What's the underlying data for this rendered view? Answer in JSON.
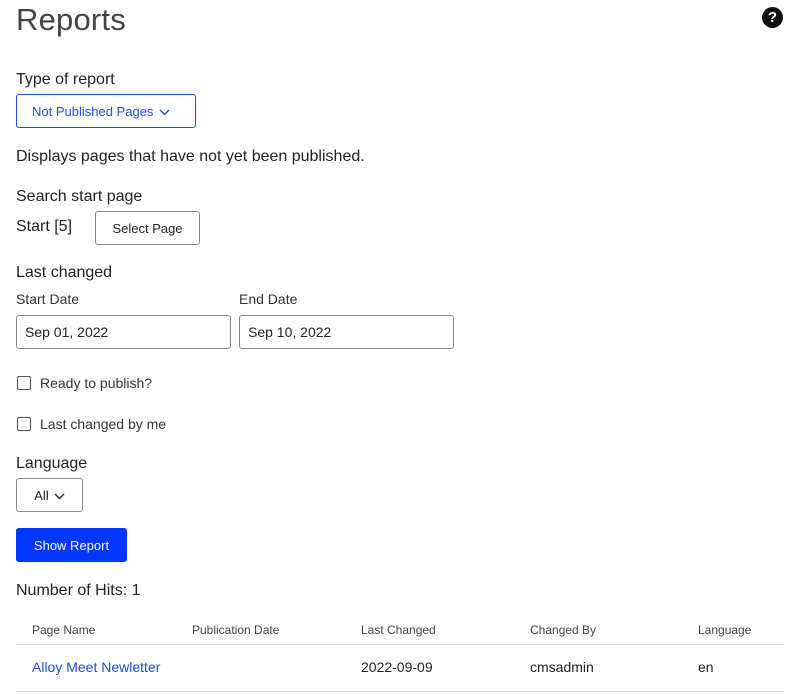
{
  "header": {
    "title": "Reports",
    "help_icon": "?"
  },
  "report_type": {
    "label": "Type of report",
    "selected": "Not Published Pages",
    "description": "Displays pages that have not yet been published."
  },
  "search": {
    "label": "Search start page",
    "start_value": "Start [5]",
    "select_button": "Select Page"
  },
  "last_changed": {
    "label": "Last changed",
    "start_label": "Start Date",
    "start_value": "Sep 01, 2022",
    "end_label": "End Date",
    "end_value": "Sep 10, 2022"
  },
  "filters": {
    "ready_to_publish": "Ready to publish?",
    "changed_by_me": "Last changed by me"
  },
  "language": {
    "label": "Language",
    "selected": "All"
  },
  "actions": {
    "show_report": "Show Report"
  },
  "results": {
    "hits_text": "Number of Hits: 1",
    "columns": [
      "Page Name",
      "Publication Date",
      "Last Changed",
      "Changed By",
      "Language"
    ],
    "rows": [
      {
        "page_name": "Alloy Meet Newletter",
        "publication_date": "",
        "last_changed": "2022-09-09",
        "changed_by": "cmsadmin",
        "language": "en"
      }
    ]
  },
  "colors": {
    "accent": "#1d4fd8",
    "primary_button": "#0037ff"
  }
}
